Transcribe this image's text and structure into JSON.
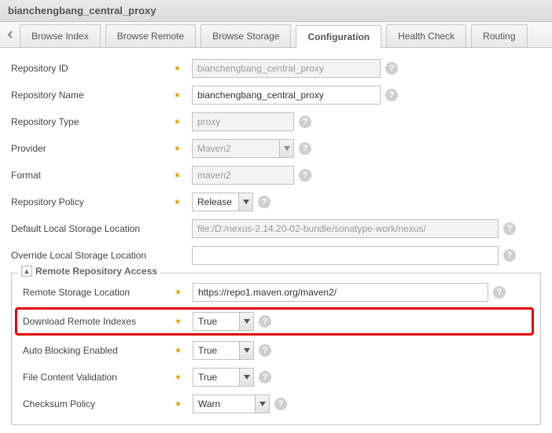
{
  "header": {
    "title": "bianchengbang_central_proxy"
  },
  "tabs": {
    "items": [
      {
        "label": "Browse Index"
      },
      {
        "label": "Browse Remote"
      },
      {
        "label": "Browse Storage"
      },
      {
        "label": "Configuration"
      },
      {
        "label": "Health Check"
      },
      {
        "label": "Routing"
      }
    ],
    "activeIndex": 3
  },
  "form": {
    "repoId": {
      "label": "Repository ID",
      "value": "bianchengbang_central_proxy"
    },
    "repoName": {
      "label": "Repository Name",
      "value": "bianchengbang_central_proxy"
    },
    "repoType": {
      "label": "Repository Type",
      "value": "proxy"
    },
    "provider": {
      "label": "Provider",
      "value": "Maven2"
    },
    "format": {
      "label": "Format",
      "value": "maven2"
    },
    "policy": {
      "label": "Repository Policy",
      "value": "Release"
    },
    "defaultStorage": {
      "label": "Default Local Storage Location",
      "value": "file:/D:/nexus-2.14.20-02-bundle/sonatype-work/nexus/"
    },
    "overrideStorage": {
      "label": "Override Local Storage Location",
      "value": ""
    }
  },
  "remoteSection": {
    "title": "Remote Repository Access",
    "remoteStorage": {
      "label": "Remote Storage Location",
      "value": "https://repo1.maven.org/maven2/"
    },
    "downloadIndexes": {
      "label": "Download Remote Indexes",
      "value": "True"
    },
    "autoBlocking": {
      "label": "Auto Blocking Enabled",
      "value": "True"
    },
    "fileValidation": {
      "label": "File Content Validation",
      "value": "True"
    },
    "checksum": {
      "label": "Checksum Policy",
      "value": "Warn"
    }
  }
}
